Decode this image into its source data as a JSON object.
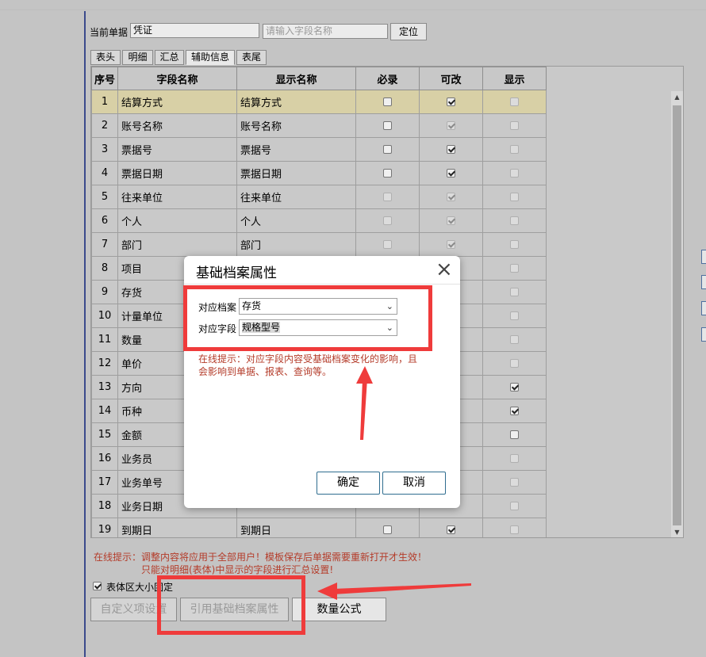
{
  "header": {
    "doc_label": "当前单据",
    "doc_value": "凭证",
    "field_placeholder": "请输入字段名称",
    "locate_button": "定位"
  },
  "tabs": [
    {
      "label": "表头",
      "active": false
    },
    {
      "label": "明细",
      "active": false
    },
    {
      "label": "汇总",
      "active": false
    },
    {
      "label": "辅助信息",
      "active": true
    },
    {
      "label": "表尾",
      "active": false
    }
  ],
  "table": {
    "columns": [
      "序号",
      "字段名称",
      "显示名称",
      "必录",
      "可改",
      "显示"
    ],
    "rows": [
      {
        "no": "1",
        "field": "结算方式",
        "display": "结算方式",
        "required": false,
        "required_enabled": true,
        "editable": true,
        "editable_enabled": true,
        "show": false,
        "show_enabled": false,
        "selected": true
      },
      {
        "no": "2",
        "field": "账号名称",
        "display": "账号名称",
        "required": false,
        "required_enabled": true,
        "editable": true,
        "editable_enabled": false,
        "show": false,
        "show_enabled": false
      },
      {
        "no": "3",
        "field": "票据号",
        "display": "票据号",
        "required": false,
        "required_enabled": true,
        "editable": true,
        "editable_enabled": true,
        "show": false,
        "show_enabled": false
      },
      {
        "no": "4",
        "field": "票据日期",
        "display": "票据日期",
        "required": false,
        "required_enabled": true,
        "editable": true,
        "editable_enabled": true,
        "show": false,
        "show_enabled": false
      },
      {
        "no": "5",
        "field": "往来单位",
        "display": "往来单位",
        "required": false,
        "required_enabled": false,
        "editable": true,
        "editable_enabled": false,
        "show": false,
        "show_enabled": false
      },
      {
        "no": "6",
        "field": "个人",
        "display": "个人",
        "required": false,
        "required_enabled": false,
        "editable": true,
        "editable_enabled": false,
        "show": false,
        "show_enabled": false
      },
      {
        "no": "7",
        "field": "部门",
        "display": "部门",
        "required": false,
        "required_enabled": false,
        "editable": true,
        "editable_enabled": false,
        "show": false,
        "show_enabled": false
      },
      {
        "no": "8",
        "field": "项目",
        "display": "",
        "show": false,
        "show_enabled": false
      },
      {
        "no": "9",
        "field": "存货",
        "display": "",
        "show": false,
        "show_enabled": false
      },
      {
        "no": "10",
        "field": "计量单位",
        "display": "",
        "show": false,
        "show_enabled": false
      },
      {
        "no": "11",
        "field": "数量",
        "display": "",
        "show": false,
        "show_enabled": false
      },
      {
        "no": "12",
        "field": "单价",
        "display": "",
        "show": false,
        "show_enabled": false
      },
      {
        "no": "13",
        "field": "方向",
        "display": "",
        "show": true,
        "show_enabled": true
      },
      {
        "no": "14",
        "field": "币种",
        "display": "",
        "show": true,
        "show_enabled": true
      },
      {
        "no": "15",
        "field": "金额",
        "display": "",
        "show": false,
        "show_enabled": true
      },
      {
        "no": "16",
        "field": "业务员",
        "display": "",
        "show": false,
        "show_enabled": false
      },
      {
        "no": "17",
        "field": "业务单号",
        "display": "",
        "show": false,
        "show_enabled": false
      },
      {
        "no": "18",
        "field": "业务日期",
        "display": "",
        "show": false,
        "show_enabled": false
      },
      {
        "no": "19",
        "field": "到期日",
        "display": "到期日",
        "required": false,
        "required_enabled": true,
        "editable": true,
        "editable_enabled": true,
        "show": false,
        "show_enabled": false
      }
    ]
  },
  "bottom": {
    "tip_line1": "在线提示：调整内容将应用于全部用户！模板保存后单据需要重新打开才生效！",
    "tip_line2": "只能对明细(表体)中显示的字段进行汇总设置!",
    "fixed_size_label": "表体区大小固定",
    "fixed_size_checked": true,
    "btn_custom": "自定义项设置",
    "btn_reference": "引用基础档案属性",
    "btn_qty_formula": "数量公式"
  },
  "modal": {
    "title": "基础档案属性",
    "archive_label": "对应档案",
    "archive_value": "存货",
    "field_label": "对应字段",
    "field_value": "规格型号",
    "tip": "在线提示：对应字段内容受基础档案变化的影响，且会影响到单据、报表、查询等。",
    "ok": "确定",
    "cancel": "取消"
  },
  "colors": {
    "annotation_red": "#ef3b3b",
    "tip_text": "#b43c2a",
    "selected_row": "#d8d0a6"
  }
}
